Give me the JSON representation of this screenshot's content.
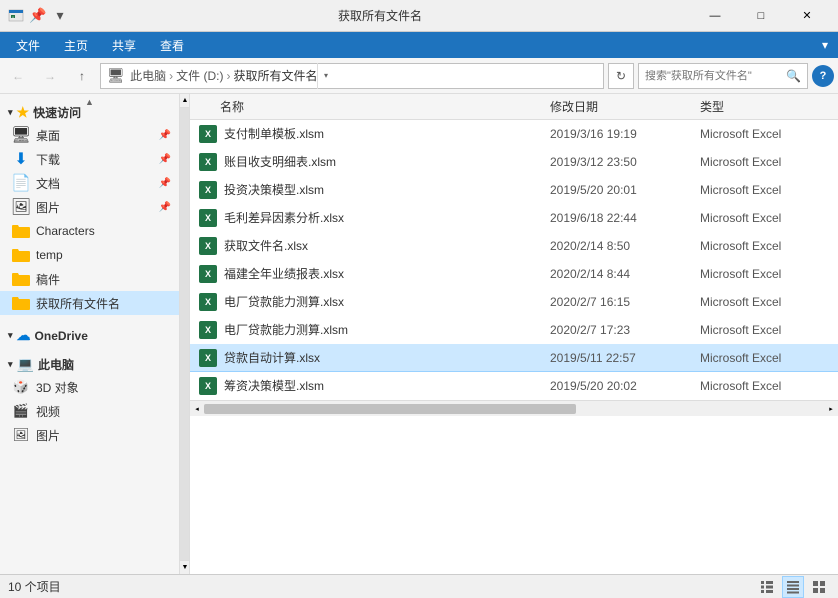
{
  "titlebar": {
    "title": "获取所有文件名",
    "minimize": "—",
    "maximize": "□",
    "close": "✕"
  },
  "ribbon": {
    "tabs": [
      "文件",
      "主页",
      "共享",
      "查看"
    ]
  },
  "addressbar": {
    "back": "←",
    "forward": "→",
    "up": "↑",
    "path": "此电脑 › 文件 (D:) › 获取所有文件名",
    "crumbs": [
      "此电脑",
      "文件 (D:)",
      "获取所有文件名"
    ],
    "search_placeholder": "搜索\"获取所有文件名\"",
    "help": "?"
  },
  "sidebar": {
    "quick_access_label": "快速访问",
    "items": [
      {
        "label": "桌面",
        "type": "desktop",
        "pin": true
      },
      {
        "label": "下载",
        "type": "download",
        "pin": true
      },
      {
        "label": "文档",
        "type": "document",
        "pin": true
      },
      {
        "label": "图片",
        "type": "picture",
        "pin": true
      },
      {
        "label": "Characters",
        "type": "folder"
      },
      {
        "label": "temp",
        "type": "folder"
      },
      {
        "label": "稿件",
        "type": "folder"
      },
      {
        "label": "获取所有文件名",
        "type": "folder",
        "selected": true
      }
    ],
    "onedrive_label": "OneDrive",
    "computer_label": "此电脑",
    "computer_items": [
      {
        "label": "3D 对象",
        "type": "3d"
      },
      {
        "label": "视频",
        "type": "video"
      },
      {
        "label": "图片",
        "type": "picture2"
      }
    ]
  },
  "file_list": {
    "columns": [
      "名称",
      "修改日期",
      "类型"
    ],
    "files": [
      {
        "name": "支付制单模板.xlsm",
        "date": "2019/3/16 19:19",
        "type": "Microsoft Excel"
      },
      {
        "name": "账目收支明细表.xlsm",
        "date": "2019/3/12 23:50",
        "type": "Microsoft Excel"
      },
      {
        "name": "投资决策模型.xlsm",
        "date": "2019/5/20 20:01",
        "type": "Microsoft Excel"
      },
      {
        "name": "毛利差异因素分析.xlsx",
        "date": "2019/6/18 22:44",
        "type": "Microsoft Excel"
      },
      {
        "name": "获取文件名.xlsx",
        "date": "2020/2/14 8:50",
        "type": "Microsoft Excel"
      },
      {
        "name": "福建全年业绩报表.xlsx",
        "date": "2020/2/14 8:44",
        "type": "Microsoft Excel"
      },
      {
        "name": "电厂贷款能力测算.xlsx",
        "date": "2020/2/7 16:15",
        "type": "Microsoft Excel"
      },
      {
        "name": "电厂贷款能力测算.xlsm",
        "date": "2020/2/7 17:23",
        "type": "Microsoft Excel"
      },
      {
        "name": "贷款自动计算.xlsx",
        "date": "2019/5/11 22:57",
        "type": "Microsoft Excel",
        "selected": true
      },
      {
        "name": "筹资决策模型.xlsm",
        "date": "2019/5/20 20:02",
        "type": "Microsoft Excel"
      }
    ]
  },
  "statusbar": {
    "count": "10 个项目",
    "view_list": "☰",
    "view_detail": "▦",
    "view_large": "▣"
  }
}
